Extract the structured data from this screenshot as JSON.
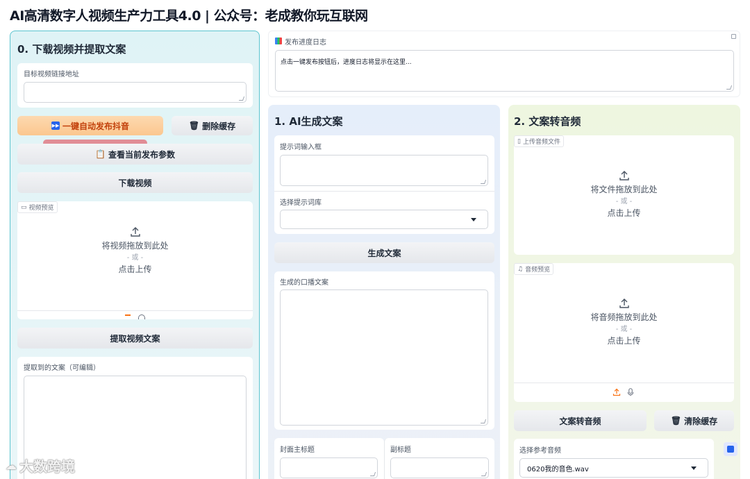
{
  "title": "AI高清数字人视频生产力工具4.0 | 公众号：老成教你玩互联网",
  "log": {
    "label": "发布进度日志",
    "placeholder": "点击一键发布按钮后，进度日志将显示在这里..."
  },
  "left": {
    "section_title": "0. 下载视频并提取文案",
    "url_label": "目标视频链接地址",
    "publish_button": "一键自动发布抖音",
    "clear_cache_button": "删除缓存",
    "view_params_button": "查看当前发布参数",
    "download_button": "下载视频",
    "video_preview_label": "视频预览",
    "upload": {
      "drop": "将视频拖放到此处",
      "or": "- 或 -",
      "click": "点击上传"
    },
    "extract_button": "提取视频文案",
    "extracted_label": "提取到的文案（可编辑）"
  },
  "mid": {
    "section_title": "1. AI生成文案",
    "prompt_label": "提示词输入框",
    "prompt_lib_label": "选择提示词库",
    "prompt_lib_value": "",
    "generate_button": "生成文案",
    "broadcast_label": "生成的口播文案",
    "cover_title_label": "封面主标题",
    "subtitle_label": "副标题"
  },
  "right": {
    "section_title": "2. 文案转音频",
    "upload_audio_label": "上传音频文件",
    "upload_audio": {
      "drop": "将文件拖放到此处",
      "or": "- 或 -",
      "click": "点击上传"
    },
    "audio_preview_label": "音频预览",
    "audio_preview": {
      "drop": "将音频拖放到此处",
      "or": "- 或 -",
      "click": "点击上传"
    },
    "tts_button": "文案转音频",
    "clear_cache_button": "清除缓存",
    "ref_audio_label": "选择参考音频",
    "ref_audio_value": "0620我的音色.wav"
  },
  "watermark": "大数跨境",
  "colors": {
    "accent_teal": "#5bc4cf",
    "orange": "#fbc78f",
    "orange_text": "#c2410c",
    "upload_icon_orange": "#f97316"
  }
}
